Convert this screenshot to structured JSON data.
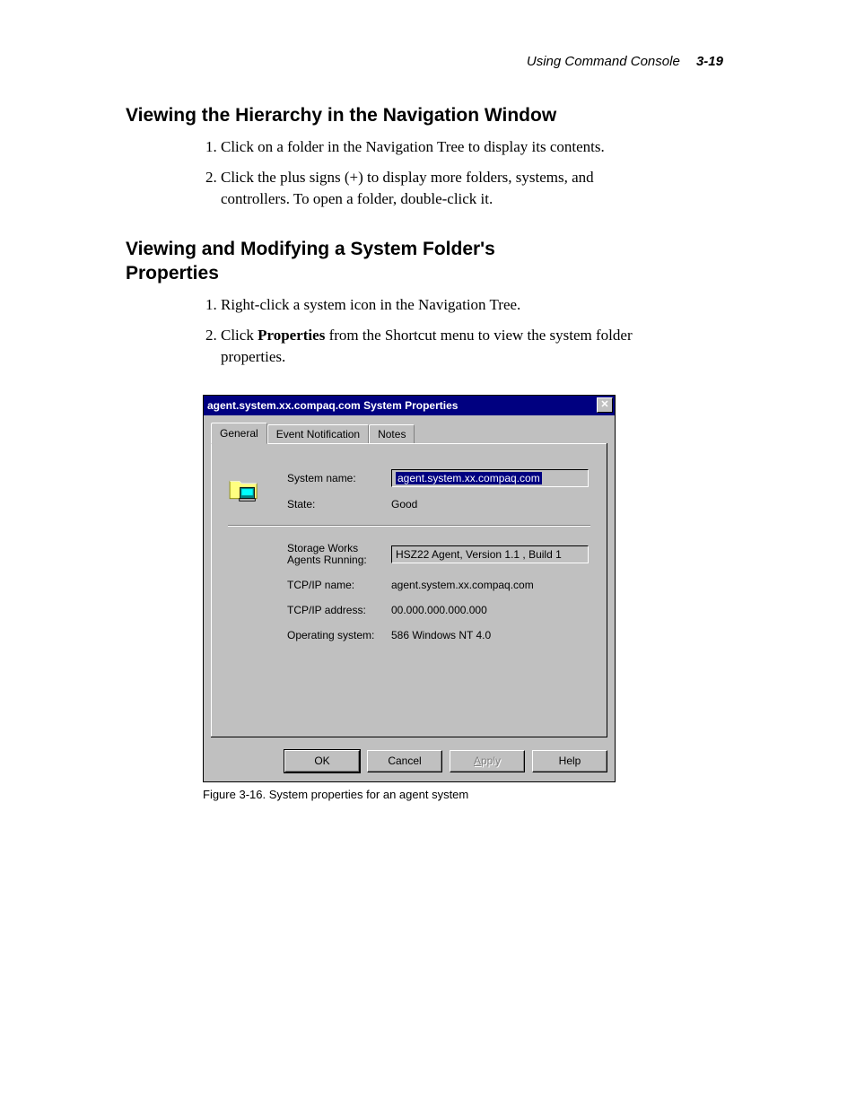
{
  "header": {
    "section_title": "Using Command Console",
    "page_number": "3-19"
  },
  "section1": {
    "heading": "Viewing the Hierarchy in the Navigation Window",
    "step1": "Click on a folder in the Navigation Tree to display its contents.",
    "step2": "Click the plus signs (+) to display more folders, systems, and controllers. To open a folder, double-click it."
  },
  "section2": {
    "heading": "Viewing and Modifying a System Folder's Properties",
    "step1": "Right-click a system icon in the Navigation Tree.",
    "step2_pre": "Click ",
    "step2_bold": "Properties",
    "step2_post": " from the Shortcut menu to view the system folder properties."
  },
  "dialog": {
    "title": "agent.system.xx.compaq.com System Properties",
    "tabs": {
      "general": "General",
      "event_notification": "Event Notification",
      "notes": "Notes"
    },
    "fields": {
      "system_name_label": "System name:",
      "system_name_value": "agent.system.xx.compaq.com",
      "state_label": "State:",
      "state_value": "Good",
      "agents_label_line1": "Storage Works",
      "agents_label_line2": "Agents Running:",
      "agents_value": "HSZ22 Agent, Version 1.1 , Build 1",
      "tcpip_name_label": "TCP/IP name:",
      "tcpip_name_value": "agent.system.xx.compaq.com",
      "tcpip_addr_label": "TCP/IP address:",
      "tcpip_addr_value": "00.000.000.000.000",
      "os_label": "Operating system:",
      "os_value": "586 Windows NT 4.0"
    },
    "buttons": {
      "ok": "OK",
      "cancel": "Cancel",
      "apply_pre": "A",
      "apply_post": "pply",
      "help": "Help"
    }
  },
  "caption": "Figure 3-16.  System properties for an agent system"
}
